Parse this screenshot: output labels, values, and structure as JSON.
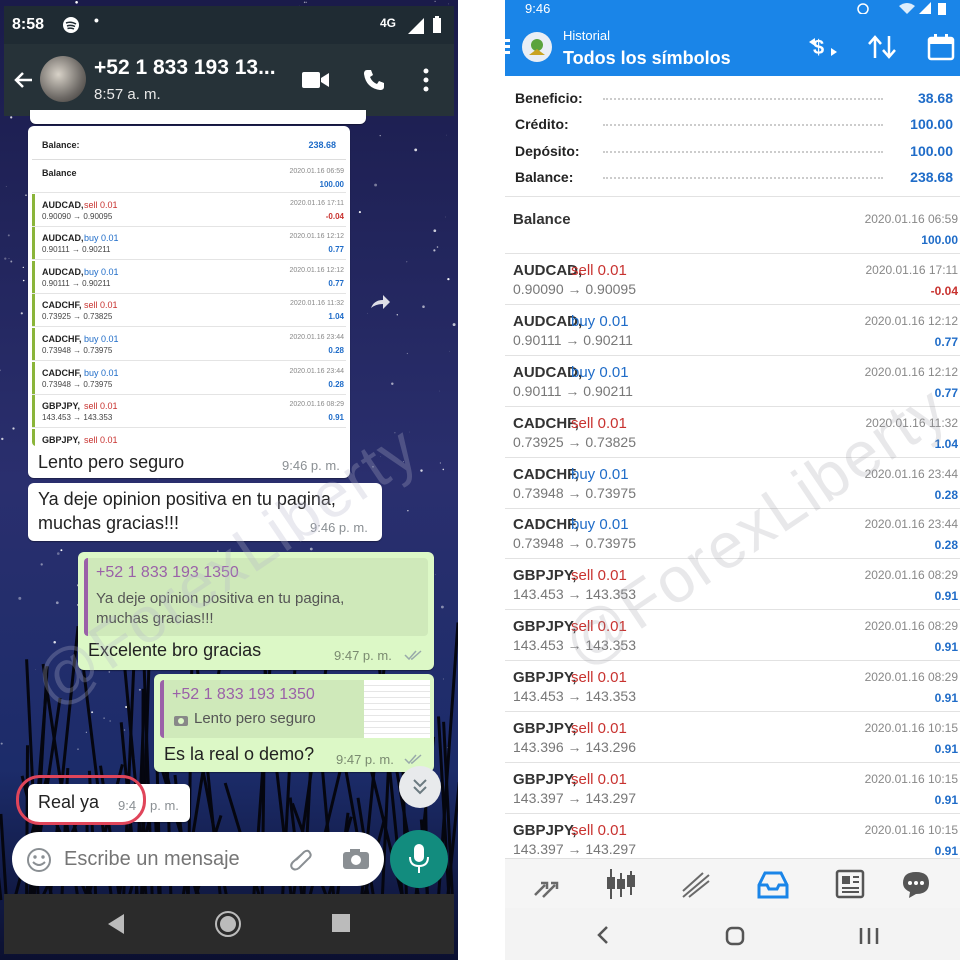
{
  "whatsapp": {
    "status_bar": {
      "time": "8:58",
      "network": "4G"
    },
    "header": {
      "contact": "+52 1 833 193 13...",
      "last_seen": "8:57 a. m."
    },
    "screenshot_message": {
      "summary": [
        {
          "label": "Balance:",
          "value": "238.68"
        }
      ],
      "rows": [
        {
          "symbol": "Balance",
          "side": "",
          "lot": "",
          "prices": "",
          "date": "2020.01.16 06:59",
          "profit": "100.00",
          "pcolor": "#1f6cc8"
        },
        {
          "symbol": "AUDCAD,",
          "side": "sell 0.01",
          "cls": "sell",
          "prices": "0.90090 → 0.90095",
          "date": "2020.01.16 17:11",
          "profit": "-0.04",
          "pcolor": "#c8322f"
        },
        {
          "symbol": "AUDCAD,",
          "side": "buy 0.01",
          "cls": "buy",
          "prices": "0.90111 → 0.90211",
          "date": "2020.01.16 12:12",
          "profit": "0.77",
          "pcolor": "#1f6cc8"
        },
        {
          "symbol": "AUDCAD,",
          "side": "buy 0.01",
          "cls": "buy",
          "prices": "0.90111 → 0.90211",
          "date": "2020.01.16 12:12",
          "profit": "0.77",
          "pcolor": "#1f6cc8"
        },
        {
          "symbol": "CADCHF,",
          "side": "sell 0.01",
          "cls": "sell",
          "prices": "0.73925 → 0.73825",
          "date": "2020.01.16 11:32",
          "profit": "1.04",
          "pcolor": "#1f6cc8"
        },
        {
          "symbol": "CADCHF,",
          "side": "buy 0.01",
          "cls": "buy",
          "prices": "0.73948 → 0.73975",
          "date": "2020.01.16 23:44",
          "profit": "0.28",
          "pcolor": "#1f6cc8"
        },
        {
          "symbol": "CADCHF,",
          "side": "buy 0.01",
          "cls": "buy",
          "prices": "0.73948 → 0.73975",
          "date": "2020.01.16 23:44",
          "profit": "0.28",
          "pcolor": "#1f6cc8"
        },
        {
          "symbol": "GBPJPY,",
          "side": "sell 0.01",
          "cls": "sell",
          "prices": "143.453 → 143.353",
          "date": "2020.01.16 08:29",
          "profit": "0.91",
          "pcolor": "#1f6cc8"
        },
        {
          "symbol": "GBPJPY,",
          "side": "sell 0.01",
          "cls": "sell",
          "prices": "",
          "date": "",
          "profit": "",
          "pcolor": "#1f6cc8"
        }
      ],
      "caption": "Lento pero seguro",
      "time": "9:46 p. m."
    },
    "msg2": {
      "text_line1": "Ya deje opinion positiva en tu pagina,",
      "text_line2": "muchas gracias!!!",
      "time": "9:46 p. m."
    },
    "msg3": {
      "quote_author": "+52 1 833 193 1350",
      "quote_line1": "Ya deje opinion positiva en tu pagina,",
      "quote_line2": "muchas gracias!!!",
      "text": "Excelente bro gracias",
      "time": "9:47 p. m."
    },
    "msg4": {
      "quote_author": "+52 1 833 193 1350",
      "quote_text": "Lento pero seguro",
      "text": "Es la real o demo?",
      "time": "9:47 p. m."
    },
    "msg5": {
      "text": "Real ya",
      "time": "9:4"
    },
    "msg5_time_tail": "p. m.",
    "input_placeholder": "Escribe un mensaje",
    "colors": {
      "header": "#263238",
      "outgoing": "#dcf8c6",
      "accent": "#128c7e",
      "highlight_circle": "#e0455a"
    }
  },
  "watermark": "@ForexLiberty",
  "mt4": {
    "status_bar": {
      "time": "9:46"
    },
    "header": {
      "title": "Historial",
      "subtitle": "Todos los símbolos"
    },
    "summary": [
      {
        "label": "Beneficio:",
        "value": "38.68"
      },
      {
        "label": "Crédito:",
        "value": "100.00"
      },
      {
        "label": "Depósito:",
        "value": "100.00"
      },
      {
        "label": "Balance:",
        "value": "238.68"
      }
    ],
    "trades": [
      {
        "symbol": "Balance",
        "side": "",
        "cls": "",
        "prices": "",
        "date": "2020.01.16 06:59",
        "profit": "100.00",
        "pcolor": "#1f6cc8"
      },
      {
        "symbol": "AUDCAD,",
        "side": "sell 0.01",
        "cls": "sell",
        "prices": "0.90090 → 0.90095",
        "date": "2020.01.16 17:11",
        "profit": "-0.04",
        "pcolor": "#c8322f"
      },
      {
        "symbol": "AUDCAD,",
        "side": "buy 0.01",
        "cls": "buy",
        "prices": "0.90111 → 0.90211",
        "date": "2020.01.16 12:12",
        "profit": "0.77",
        "pcolor": "#1f6cc8"
      },
      {
        "symbol": "AUDCAD,",
        "side": "buy 0.01",
        "cls": "buy",
        "prices": "0.90111 → 0.90211",
        "date": "2020.01.16 12:12",
        "profit": "0.77",
        "pcolor": "#1f6cc8"
      },
      {
        "symbol": "CADCHF,",
        "side": "sell 0.01",
        "cls": "sell",
        "prices": "0.73925 → 0.73825",
        "date": "2020.01.16 11:32",
        "profit": "1.04",
        "pcolor": "#1f6cc8"
      },
      {
        "symbol": "CADCHF,",
        "side": "buy 0.01",
        "cls": "buy",
        "prices": "0.73948 → 0.73975",
        "date": "2020.01.16 23:44",
        "profit": "0.28",
        "pcolor": "#1f6cc8"
      },
      {
        "symbol": "CADCHF,",
        "side": "buy 0.01",
        "cls": "buy",
        "prices": "0.73948 → 0.73975",
        "date": "2020.01.16 23:44",
        "profit": "0.28",
        "pcolor": "#1f6cc8"
      },
      {
        "symbol": "GBPJPY,",
        "side": "sell 0.01",
        "cls": "sell",
        "prices": "143.453 → 143.353",
        "date": "2020.01.16 08:29",
        "profit": "0.91",
        "pcolor": "#1f6cc8"
      },
      {
        "symbol": "GBPJPY,",
        "side": "sell 0.01",
        "cls": "sell",
        "prices": "143.453 → 143.353",
        "date": "2020.01.16 08:29",
        "profit": "0.91",
        "pcolor": "#1f6cc8"
      },
      {
        "symbol": "GBPJPY,",
        "side": "sell 0.01",
        "cls": "sell",
        "prices": "143.453 → 143.353",
        "date": "2020.01.16 08:29",
        "profit": "0.91",
        "pcolor": "#1f6cc8"
      },
      {
        "symbol": "GBPJPY,",
        "side": "sell 0.01",
        "cls": "sell",
        "prices": "143.396 → 143.296",
        "date": "2020.01.16 10:15",
        "profit": "0.91",
        "pcolor": "#1f6cc8"
      },
      {
        "symbol": "GBPJPY,",
        "side": "sell 0.01",
        "cls": "sell",
        "prices": "143.397 → 143.297",
        "date": "2020.01.16 10:15",
        "profit": "0.91",
        "pcolor": "#1f6cc8"
      },
      {
        "symbol": "GBPJPY,",
        "side": "sell 0.01",
        "cls": "sell",
        "prices": "143.397 → 143.297",
        "date": "2020.01.16 10:15",
        "profit": "0.91",
        "pcolor": "#1f6cc8"
      }
    ],
    "colors": {
      "header": "#1a85e8",
      "sell": "#c8322f",
      "buy": "#1f6cc8"
    }
  }
}
